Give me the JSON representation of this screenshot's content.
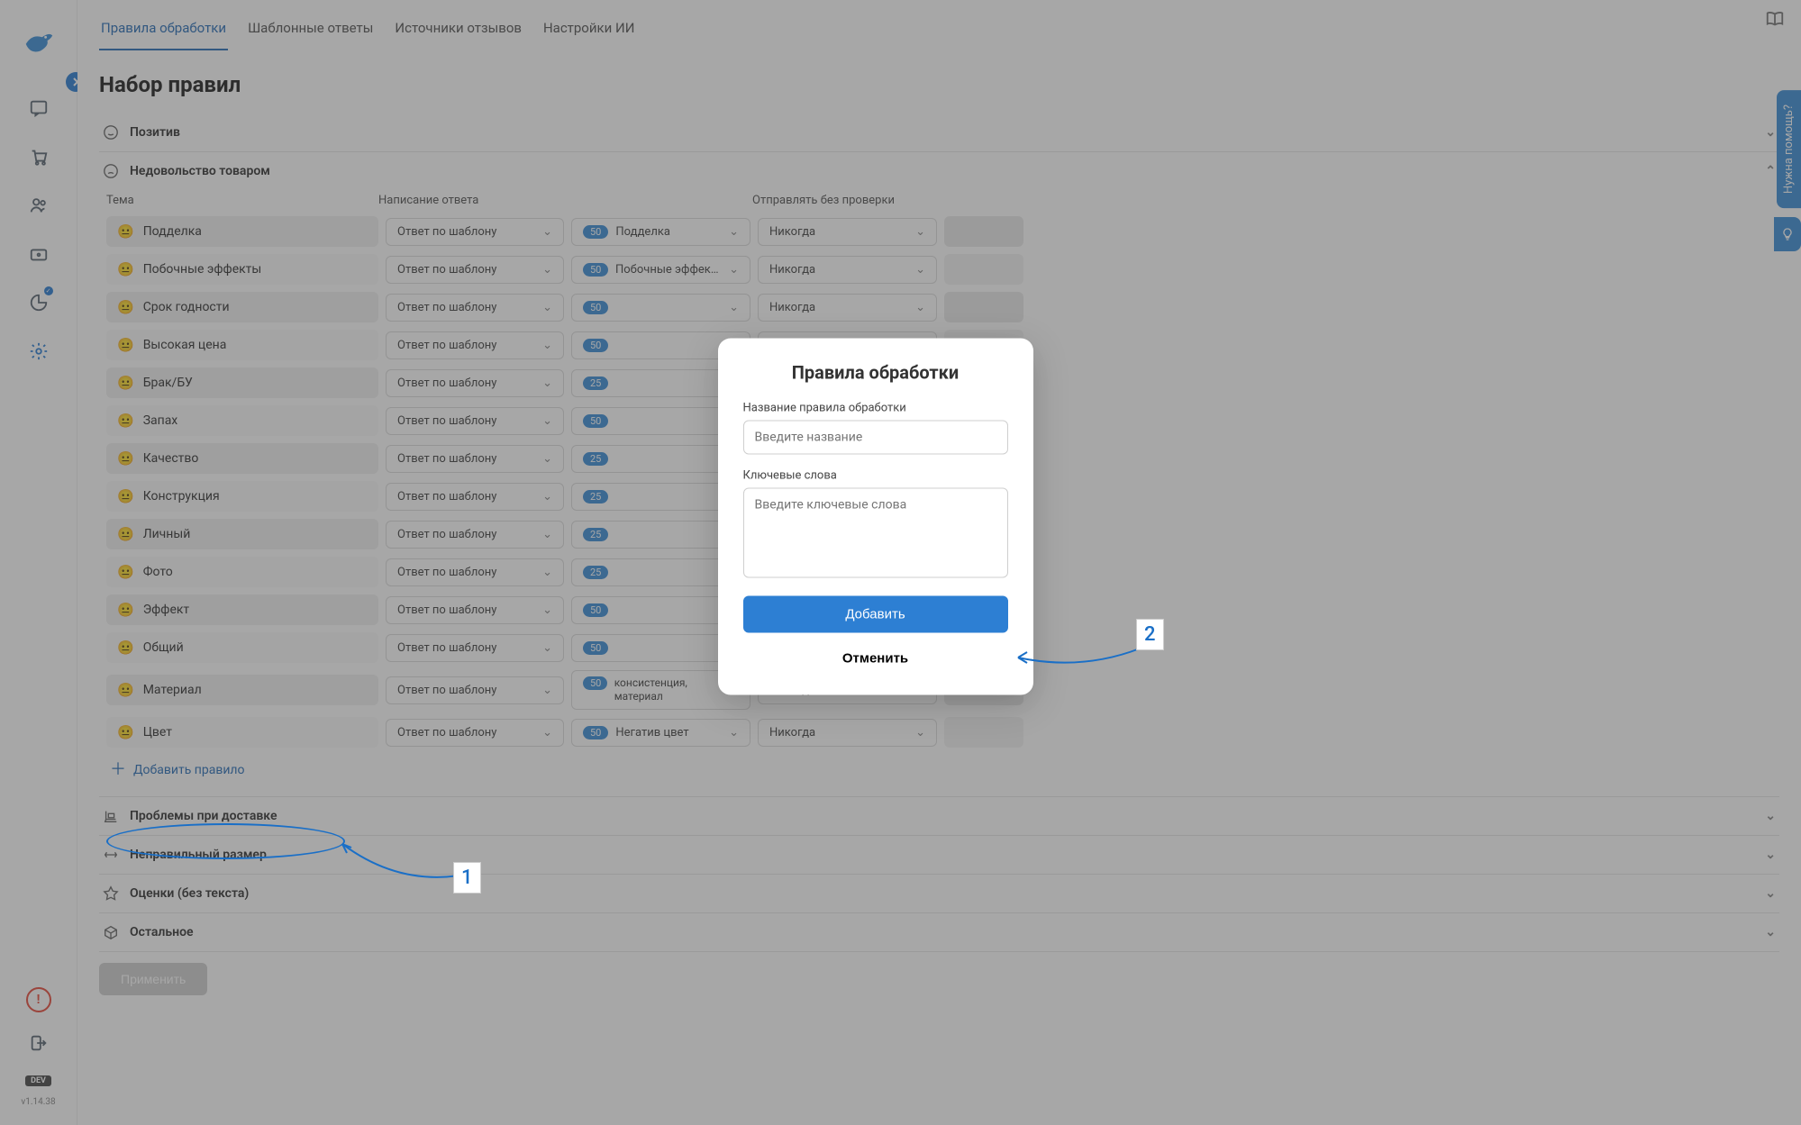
{
  "tabs": [
    "Правила обработки",
    "Шаблонные ответы",
    "Источники отзывов",
    "Настройки ИИ"
  ],
  "page_title": "Набор правил",
  "sections": {
    "positive": "Позитив",
    "dissatisfied": "Недовольство товаром",
    "delivery": "Проблемы при доставке",
    "wrong_size": "Неправильный размер",
    "no_text": "Оценки (без текста)",
    "other": "Остальное"
  },
  "table_head": {
    "theme": "Тема",
    "answer": "Написание ответа",
    "send": "Отправлять без проверки"
  },
  "answer_by_template": "Ответ по шаблону",
  "never": "Никогда",
  "rules": [
    {
      "name": "Подделка",
      "badge": "50",
      "template": "Подделка"
    },
    {
      "name": "Побочные эффекты",
      "badge": "50",
      "template": "Побочные эффекты"
    },
    {
      "name": "Срок годности",
      "badge": "50",
      "template": ""
    },
    {
      "name": "Высокая цена",
      "badge": "50",
      "template": ""
    },
    {
      "name": "Брак/БУ",
      "badge": "25",
      "template": ""
    },
    {
      "name": "Запах",
      "badge": "50",
      "template": ""
    },
    {
      "name": "Качество",
      "badge": "25",
      "template": ""
    },
    {
      "name": "Конструкция",
      "badge": "25",
      "template": ""
    },
    {
      "name": "Личный",
      "badge": "25",
      "template": ""
    },
    {
      "name": "Фото",
      "badge": "25",
      "template": ""
    },
    {
      "name": "Эффект",
      "badge": "50",
      "template": ""
    },
    {
      "name": "Общий",
      "badge": "50",
      "template": ""
    },
    {
      "name": "Материал",
      "badge": "50",
      "template": "консистенция, материал",
      "multi": true
    },
    {
      "name": "Цвет",
      "badge": "50",
      "template": "Негатив цвет"
    }
  ],
  "add_rule": "Добавить правило",
  "apply": "Применить",
  "help": "Нужна помощь?",
  "dev": "DEV",
  "version": "v1.14.38",
  "modal": {
    "title": "Правила обработки",
    "name_label": "Название правила обработки",
    "name_placeholder": "Введите название",
    "keywords_label": "Ключевые слова",
    "keywords_placeholder": "Введите ключевые слова",
    "add": "Добавить",
    "cancel": "Отменить"
  },
  "annot": {
    "l1": "1",
    "l2": "2"
  }
}
